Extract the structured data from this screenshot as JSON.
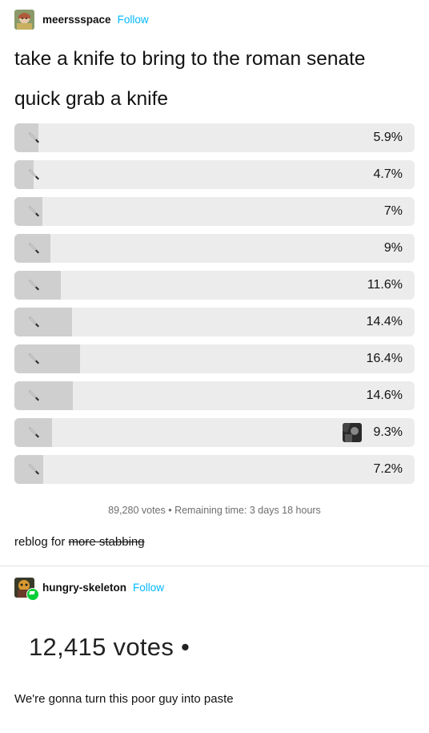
{
  "post": {
    "author": "meerssspace",
    "follow_label": "Follow",
    "title": "take a knife to bring to the roman senate quick grab a knife",
    "poll": {
      "options": [
        {
          "label": "🔪",
          "percent_text": "5.9%",
          "percent": 5.9
        },
        {
          "label": "🔪",
          "percent_text": "4.7%",
          "percent": 4.7
        },
        {
          "label": "🔪",
          "percent_text": "7%",
          "percent": 7
        },
        {
          "label": "🔪",
          "percent_text": "9%",
          "percent": 9
        },
        {
          "label": "🔪",
          "percent_text": "11.6%",
          "percent": 11.6
        },
        {
          "label": "🔪",
          "percent_text": "14.4%",
          "percent": 14.4
        },
        {
          "label": "🔪",
          "percent_text": "16.4%",
          "percent": 16.4
        },
        {
          "label": "🔪",
          "percent_text": "14.6%",
          "percent": 14.6
        },
        {
          "label": "🔪",
          "percent_text": "9.3%",
          "percent": 9.3,
          "voted": true
        },
        {
          "label": "🔪",
          "percent_text": "7.2%",
          "percent": 7.2
        }
      ],
      "meta": "89,280 votes • Remaining time: 3 days 18 hours"
    },
    "caption_prefix": "reblog for ",
    "caption_struck": "more stabbing"
  },
  "reblog": {
    "author": "hungry-skeleton",
    "follow_label": "Follow",
    "image_text": "12,415 votes •",
    "body": "We're gonna turn this poor guy into paste"
  },
  "colors": {
    "follow": "#00b8ff",
    "bar_track": "#ececec",
    "bar_fill": "#cfcfcf",
    "reblog_badge": "#00cf35"
  },
  "icons": {
    "option_icon": "knife-icon",
    "reblog_badge": "reblog-icon"
  }
}
